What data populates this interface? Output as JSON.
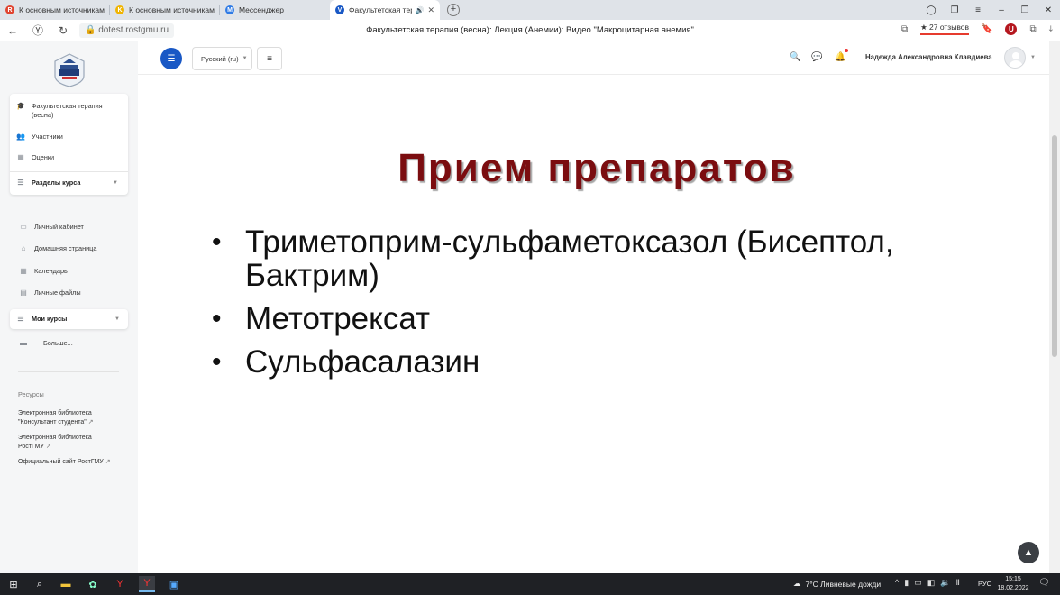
{
  "browser": {
    "tabs": [
      {
        "title": "К основным источникам",
        "favicon_color": "#e0432f",
        "favicon_glyph": "R"
      },
      {
        "title": "К основным источникам",
        "favicon_color": "#f0b400",
        "favicon_glyph": "K"
      },
      {
        "title": "Мессенджер",
        "favicon_color": "#2f7be5",
        "favicon_glyph": "M"
      },
      {
        "title": "Факультетская терап",
        "favicon_color": "#1958c5",
        "favicon_glyph": "V",
        "active": true
      }
    ],
    "close_glyph": "✕",
    "new_tab_glyph": "+",
    "url": "dotest.rostgmu.ru",
    "page_title": "Факультетская терапия (весна): Лекция (Анемии): Видео \"Макроцитарная анемия\"",
    "reviews": "★ 27 отзывов",
    "ublock_glyph": "U"
  },
  "sidebar": {
    "course_card": {
      "course": "Факультетская терапия (весна)",
      "participants": "Участники",
      "grades": "Оценки",
      "sections": "Разделы курса"
    },
    "nav": {
      "dashboard": "Личный кабинет",
      "home": "Домашняя страница",
      "calendar": "Календарь",
      "files": "Личные файлы",
      "my_courses": "Мои курсы",
      "more": "Больше..."
    },
    "resources": {
      "heading": "Ресурсы",
      "link1": "Электронная библиотека \"Консультант студента\"",
      "link2": "Электронная библиотека РостГМУ",
      "link3": "Официальный сайт РостГМУ"
    }
  },
  "header": {
    "language": "Русский (ru)",
    "username": "Надежда Александровна Клавдиева"
  },
  "slide": {
    "title": "Прием препаратов",
    "bullets": [
      "Триметоприм-сульфаметоксазол (Бисептол, Бактрим)",
      "Метотрексат",
      "Сульфасалазин"
    ]
  },
  "taskbar": {
    "weather": "7°C  Ливневые дожди",
    "language": "РУС",
    "time": "15:15",
    "date": "18.02.2022"
  },
  "colors": {
    "accent": "#1958c5",
    "slide_title": "#7b0d10"
  }
}
